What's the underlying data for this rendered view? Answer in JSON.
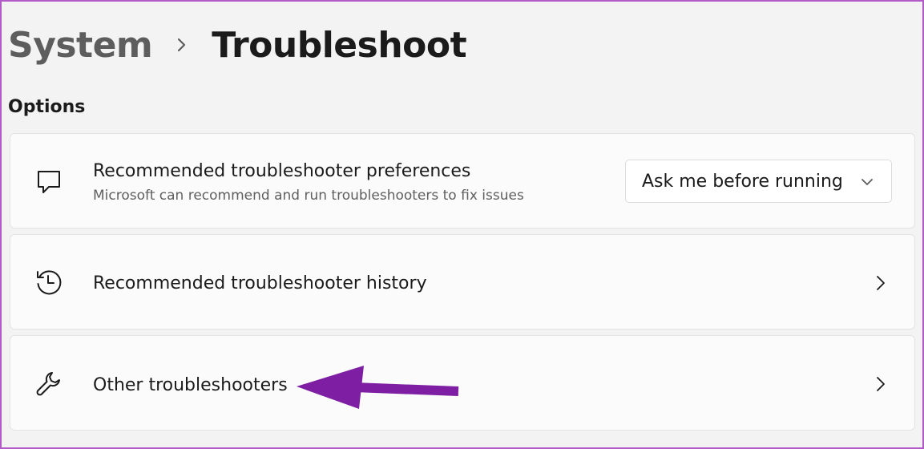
{
  "header": {
    "parent": "System",
    "current": "Troubleshoot"
  },
  "section": {
    "title": "Options"
  },
  "items": [
    {
      "title": "Recommended troubleshooter preferences",
      "subtitle": "Microsoft can recommend and run troubleshooters to fix issues",
      "icon": "chat-bubble-icon",
      "dropdown": {
        "selected": "Ask me before running"
      }
    },
    {
      "title": "Recommended troubleshooter history",
      "icon": "history-clock-icon"
    },
    {
      "title": "Other troubleshooters",
      "icon": "wrench-icon"
    }
  ],
  "colors": {
    "annotation_arrow": "#7e1fa3",
    "frame": "#b25ac8"
  }
}
